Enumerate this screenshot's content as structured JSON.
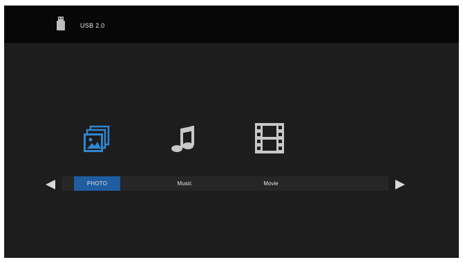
{
  "header": {
    "device_label": "USB 2.0",
    "device_icon": "usb-drive-icon"
  },
  "categories": [
    {
      "label": "PHOTO",
      "icon": "photo-icon",
      "selected": true
    },
    {
      "label": "Music",
      "icon": "music-note-icon",
      "selected": false
    },
    {
      "label": "Movie",
      "icon": "film-strip-icon",
      "selected": false
    }
  ],
  "navigation": {
    "left_icon": "arrow-left-icon",
    "right_icon": "arrow-right-icon"
  },
  "colors": {
    "selected_accent": "#1f5da0",
    "photo_icon": "#2f86d0",
    "inactive_icon": "#c8c8c8",
    "background": "#1d1d1d",
    "header_background": "#070707"
  }
}
